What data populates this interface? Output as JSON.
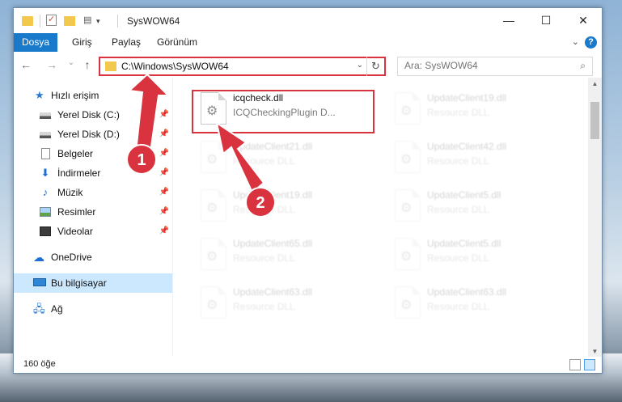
{
  "window": {
    "title": "SysWOW64",
    "controls": {
      "minimize": "—",
      "maximize": "☐",
      "close": "✕"
    }
  },
  "ribbon": {
    "file_tab": "Dosya",
    "tabs": [
      "Giriş",
      "Paylaş",
      "Görünüm"
    ]
  },
  "nav": {
    "back": "←",
    "forward": "→",
    "recent": "⌄",
    "up": "↑",
    "address": "C:\\Windows\\SysWOW64",
    "address_dropdown": "⌄",
    "refresh": "↻",
    "search_placeholder": "Ara: SysWOW64",
    "search_icon": "⌕"
  },
  "sidebar": {
    "items": [
      {
        "label": "Hızlı erişim",
        "icon": "star-icon"
      },
      {
        "label": "Yerel Disk (C:)",
        "icon": "drive-icon",
        "pinned": true
      },
      {
        "label": "Yerel Disk (D:)",
        "icon": "drive-icon",
        "pinned": true
      },
      {
        "label": "Belgeler",
        "icon": "documents-icon",
        "pinned": true
      },
      {
        "label": "İndirmeler",
        "icon": "downloads-icon",
        "pinned": true
      },
      {
        "label": "Müzik",
        "icon": "music-icon",
        "pinned": true
      },
      {
        "label": "Resimler",
        "icon": "pictures-icon",
        "pinned": true
      },
      {
        "label": "Videolar",
        "icon": "videos-icon",
        "pinned": true
      },
      {
        "label": "OneDrive",
        "icon": "onedrive-icon"
      },
      {
        "label": "Bu bilgisayar",
        "icon": "computer-icon",
        "selected": true
      },
      {
        "label": "Ağ",
        "icon": "network-icon"
      }
    ],
    "pin_glyph": "📌"
  },
  "files": [
    {
      "name": "icqcheck.dll",
      "type": "ICQCheckingPlugin D...",
      "highlighted": true
    },
    {
      "name": "UpdateClient19.dll",
      "type": "Resource DLL"
    },
    {
      "name": "UpdateClient21.dll",
      "type": "Resource DLL"
    },
    {
      "name": "UpdateClient42.dll",
      "type": "Resource DLL"
    },
    {
      "name": "UpdateClient19.dll",
      "type": "Resource DLL"
    },
    {
      "name": "UpdateClient5.dll",
      "type": "Resource DLL"
    },
    {
      "name": "UpdateClient65.dll",
      "type": "Resource DLL"
    },
    {
      "name": "UpdateClient5.dll",
      "type": "Resource DLL"
    },
    {
      "name": "UpdateClient63.dll",
      "type": "Resource DLL"
    },
    {
      "name": "UpdateClient63.dll",
      "type": "Resource DLL"
    }
  ],
  "status": {
    "count": "160 öğe"
  },
  "annotations": {
    "badge1": "1",
    "badge2": "2",
    "color": "#d9333f"
  }
}
